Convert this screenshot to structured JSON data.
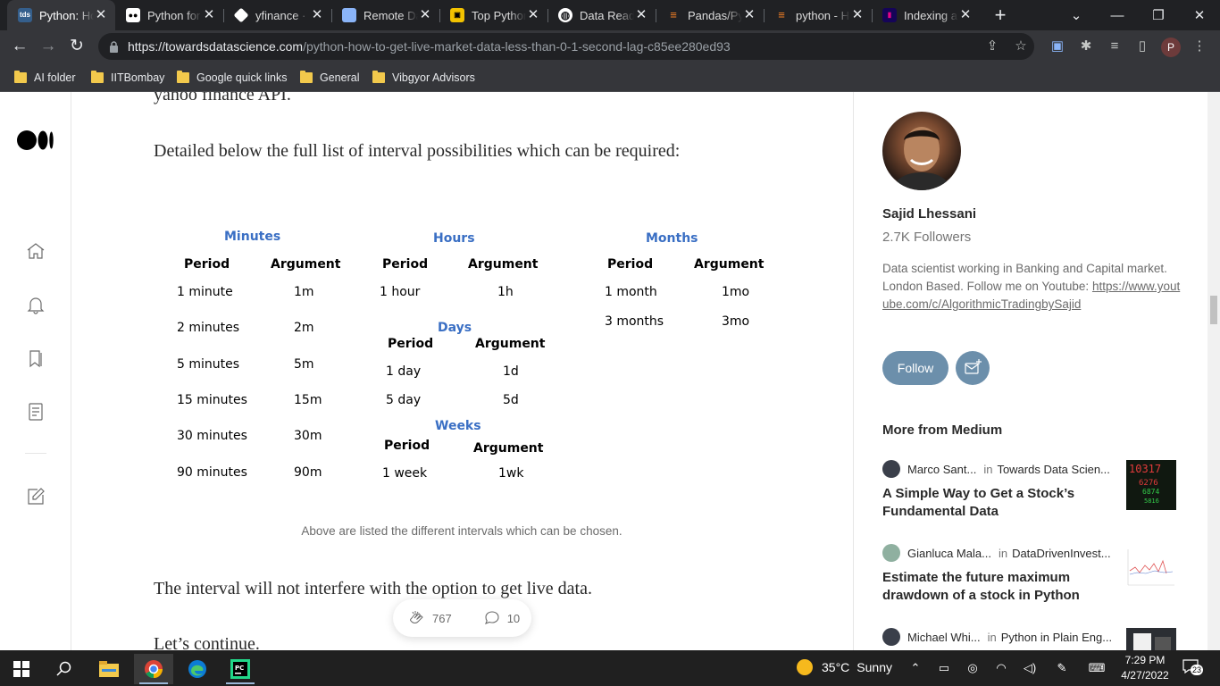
{
  "browser": {
    "tabs": [
      {
        "title": "Python: How to Get Live Market Data",
        "favicon": "tds-icon",
        "active": true
      },
      {
        "title": "Python for Finance",
        "favicon": "medium-icon"
      },
      {
        "title": "yfinance · PyPI",
        "favicon": "pypi-icon"
      },
      {
        "title": "Remote Data Access",
        "favicon": "doc-icon"
      },
      {
        "title": "Top Python Libraries",
        "favicon": "yellow-icon"
      },
      {
        "title": "Data Reader",
        "favicon": "globe-icon"
      },
      {
        "title": "Pandas/Python",
        "favicon": "stackoverflow-icon"
      },
      {
        "title": "python - How to",
        "favicon": "stackoverflow-icon"
      },
      {
        "title": "Indexing and Selecting",
        "favicon": "pandas-icon"
      }
    ],
    "url_host": "https://towardsdatascience.com",
    "url_path": "/python-how-to-get-live-market-data-less-than-0-1-second-lag-c85ee280ed93",
    "profile_initial": "P",
    "bookmarks": [
      "AI folder",
      "IITBombay",
      "Google quick links",
      "General",
      "Vibgyor Advisors"
    ]
  },
  "article": {
    "line_top": "yahoo finance API.",
    "para1": "Detailed below the full list of interval possibilities which can be required:",
    "figure": {
      "minutes_title": "Minutes",
      "hours_title": "Hours",
      "months_title": "Months",
      "days_title": "Days",
      "weeks_title": "Weeks",
      "period_header": "Period",
      "argument_header": "Argument",
      "minutes": [
        {
          "period": "1 minute",
          "arg": "1m"
        },
        {
          "period": "2 minutes",
          "arg": "2m"
        },
        {
          "period": "5 minutes",
          "arg": "5m"
        },
        {
          "period": "15 minutes",
          "arg": "15m"
        },
        {
          "period": "30 minutes",
          "arg": "30m"
        },
        {
          "period": "90 minutes",
          "arg": "90m"
        }
      ],
      "hours": [
        {
          "period": "1 hour",
          "arg": "1h"
        }
      ],
      "days": [
        {
          "period": "1 day",
          "arg": "1d"
        },
        {
          "period": "5 day",
          "arg": "5d"
        }
      ],
      "weeks": [
        {
          "period": "1 week",
          "arg": "1wk"
        }
      ],
      "months": [
        {
          "period": "1 month",
          "arg": "1mo"
        },
        {
          "period": "3 months",
          "arg": "3mo"
        }
      ]
    },
    "caption": "Above are listed the different intervals which can be chosen.",
    "para2": "The interval will not interfere with the option to get live data.",
    "para3": "Let’s continue.",
    "claps": "767",
    "responses": "10"
  },
  "sidebar": {
    "author_name": "Sajid Lhessani",
    "followers": "2.7K Followers",
    "bio": "Data scientist working in Banking and Capital market. London Based. Follow me on Youtube:",
    "bio_link": "https://www.youtube.com/c/AlgorithmicTradingbySajid",
    "follow_label": "Follow",
    "more_heading": "More from Medium",
    "stories": [
      {
        "author": "Marco Sant...",
        "in": "in",
        "publication": "Towards Data Scien...",
        "title": "A Simple Way to Get a Stock’s Fundamental Data"
      },
      {
        "author": "Gianluca Mala...",
        "in": "in",
        "publication": "DataDrivenInvest...",
        "title": "Estimate the future maximum drawdown of a stock in Python"
      },
      {
        "author": "Michael Whi...",
        "in": "in",
        "publication": "Python in Plain Eng...",
        "title": ""
      }
    ]
  },
  "taskbar": {
    "weather_temp": "35°C",
    "weather_desc": "Sunny",
    "time": "7:29 PM",
    "date": "4/27/2022",
    "notifications": "23"
  }
}
